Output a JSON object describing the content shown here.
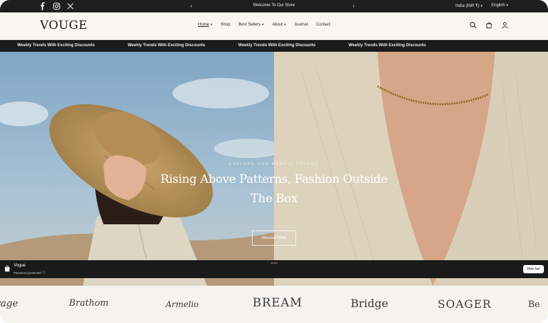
{
  "announcement": {
    "message": "Welcome To Our Store",
    "prev_arrow": "‹",
    "next_arrow": "›",
    "country": "India (INR ₹)",
    "language": "English",
    "social_icons": [
      "facebook-icon",
      "instagram-icon",
      "x-icon"
    ]
  },
  "header": {
    "logo": "VOUGE",
    "nav": [
      {
        "label": "Home",
        "dropdown": true,
        "active": true
      },
      {
        "label": "Shop",
        "dropdown": false
      },
      {
        "label": "Best Sellers",
        "dropdown": true
      },
      {
        "label": "About",
        "dropdown": true
      },
      {
        "label": "Journal",
        "dropdown": false
      },
      {
        "label": "Contact",
        "dropdown": false
      }
    ],
    "tool_icons": [
      "search-icon",
      "cart-icon",
      "account-icon"
    ]
  },
  "ticker": {
    "items": [
      "Weekly Trends With Exciting Discounts",
      "Weekly Trends With Exciting Discounts",
      "Weekly Trends With Exciting Discounts",
      "Weekly Trends With Exciting Discounts"
    ]
  },
  "hero": {
    "kicker": "EXPLORE OUR WEEKLY TRENDS",
    "title": "Rising Above Patterns, Fashion Outside The Box",
    "button": "Discover More"
  },
  "preview_bar": {
    "store": "Vogue",
    "status": "Password protected",
    "hide_button": "Hide bar"
  },
  "brands": [
    "rage",
    "Brathom",
    "Armelio",
    "BREAM",
    "Bridge",
    "SOAGER",
    "Be"
  ],
  "colors": {
    "background": "#f4f3ee",
    "dark_bar": "#1f1f1f",
    "text": "#2a2a2a",
    "accent_white": "#ffffff"
  }
}
